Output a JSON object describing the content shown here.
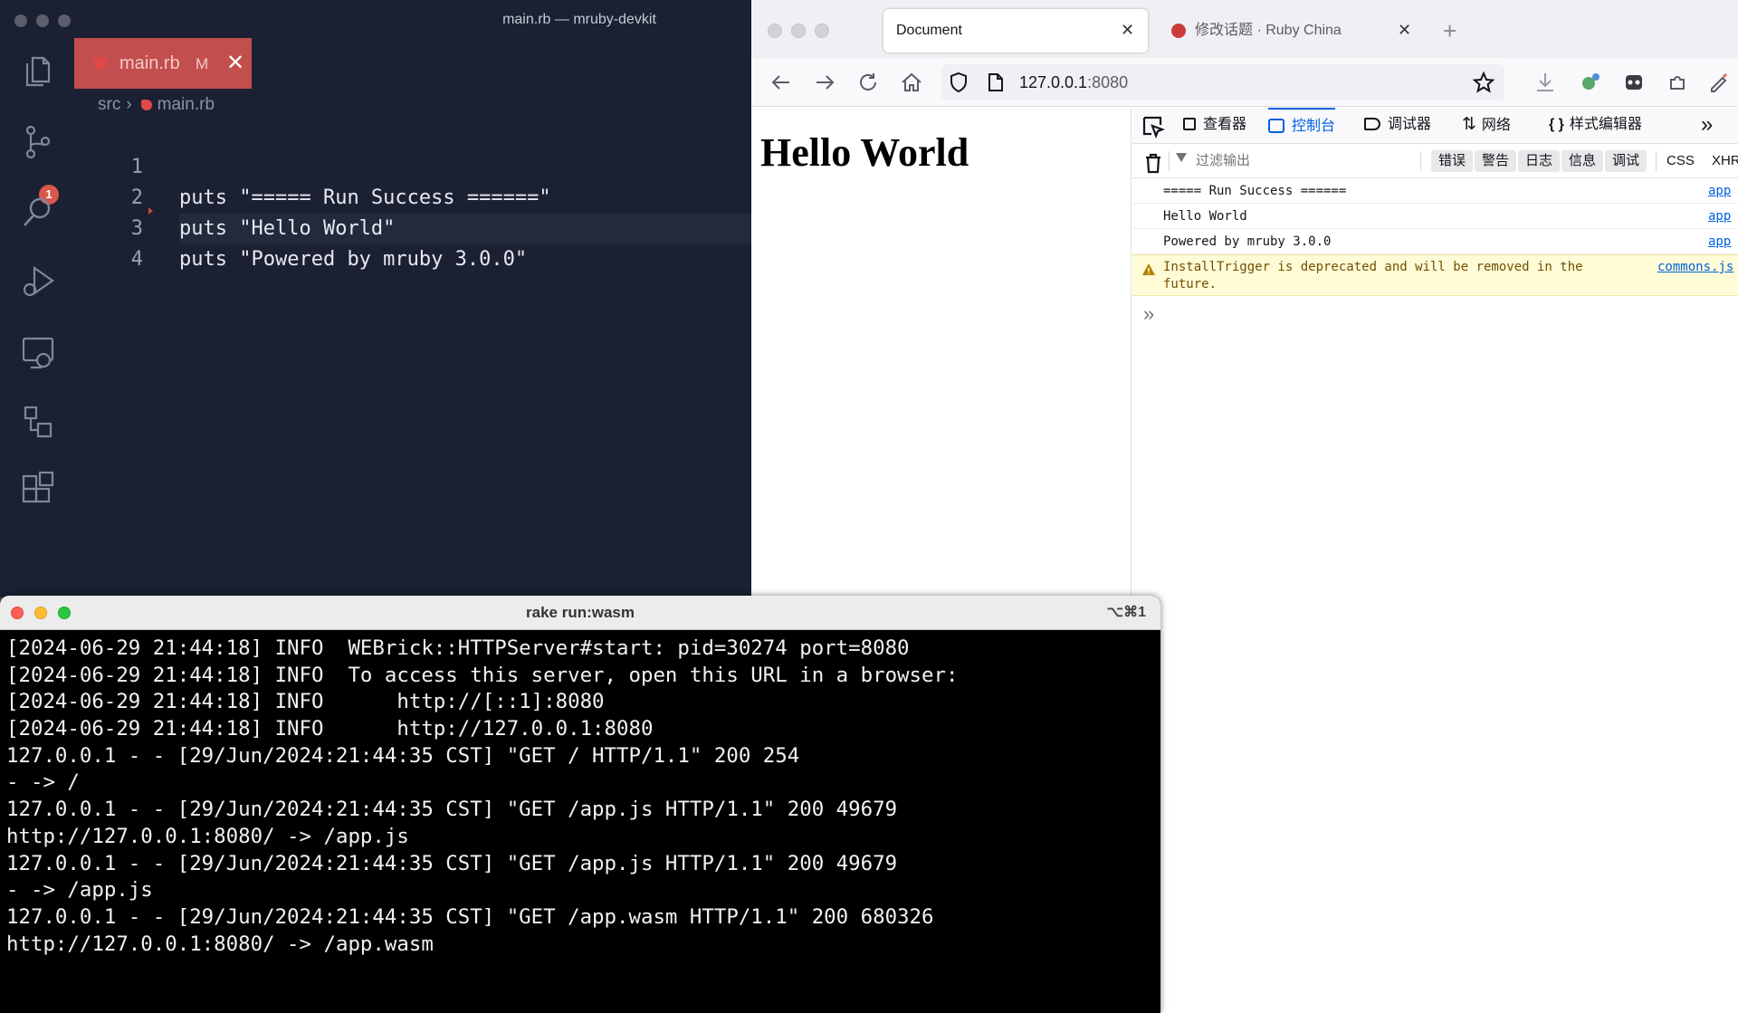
{
  "vscode": {
    "window_title": "main.rb — mruby-devkit",
    "scm_badge": "1",
    "tab": {
      "filename": "main.rb",
      "modified": "M",
      "close": "✕"
    },
    "breadcrumb": {
      "folder": "src",
      "separator": "›",
      "file": "main.rb"
    },
    "lines": [
      {
        "num": "1",
        "kw": "puts",
        "str": "\"===== Run Success ======\""
      },
      {
        "num": "2",
        "kw": "puts",
        "str": "\"Hello World\""
      },
      {
        "num": "3",
        "kw": "puts",
        "str": "\"Powered by mruby 3.0.0\""
      },
      {
        "num": "4",
        "kw": "",
        "str": ""
      }
    ],
    "colors": {
      "background": "#1b2132",
      "tab_active": "#c24f4d",
      "badge": "#d9574b"
    }
  },
  "browser": {
    "tabs": [
      {
        "label": "Document",
        "close": "✕",
        "active": true
      },
      {
        "label": "修改话题 · Ruby China",
        "close": "✕",
        "active": false
      }
    ],
    "new_tab": "+",
    "url_host": "127.0.0.1",
    "url_port": ":8080",
    "page_heading": "Hello World",
    "devtools": {
      "tabs": [
        "查看器",
        "控制台",
        "调试器",
        "网络",
        "样式编辑器"
      ],
      "overflow": "»",
      "filter_placeholder": "过滤输出",
      "filter_buttons": [
        "错误",
        "警告",
        "日志",
        "信息",
        "调试"
      ],
      "css_label": "CSS",
      "xhr_label": "XHR",
      "logs": [
        {
          "text": "===== Run Success ======",
          "source": "app"
        },
        {
          "text": "Hello World",
          "source": "app"
        },
        {
          "text": "Powered by mruby 3.0.0",
          "source": "app"
        }
      ],
      "warning": {
        "text": "InstallTrigger is deprecated and will be removed in the future.",
        "source": "commons.js"
      },
      "prompt": "»"
    },
    "colors": {
      "accent": "#0060df",
      "warning_bg": "#fffbd6"
    }
  },
  "terminal": {
    "title": "rake run:wasm",
    "shortcut": "⌥⌘1",
    "lines": [
      "[2024-06-29 21:44:18] INFO  WEBrick::HTTPServer#start: pid=30274 port=8080",
      "[2024-06-29 21:44:18] INFO  To access this server, open this URL in a browser:",
      "[2024-06-29 21:44:18] INFO      http://[::1]:8080",
      "[2024-06-29 21:44:18] INFO      http://127.0.0.1:8080",
      "127.0.0.1 - - [29/Jun/2024:21:44:35 CST] \"GET / HTTP/1.1\" 200 254",
      "- -> /",
      "127.0.0.1 - - [29/Jun/2024:21:44:35 CST] \"GET /app.js HTTP/1.1\" 200 49679",
      "http://127.0.0.1:8080/ -> /app.js",
      "127.0.0.1 - - [29/Jun/2024:21:44:35 CST] \"GET /app.js HTTP/1.1\" 200 49679",
      "- -> /app.js",
      "127.0.0.1 - - [29/Jun/2024:21:44:35 CST] \"GET /app.wasm HTTP/1.1\" 200 680326",
      "http://127.0.0.1:8080/ -> /app.wasm"
    ],
    "colors": {
      "background": "#000000",
      "text": "#f2f2f2"
    }
  }
}
